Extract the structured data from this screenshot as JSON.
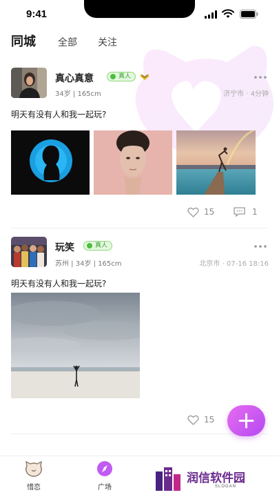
{
  "status_bar": {
    "time": "9:41"
  },
  "tabs": [
    {
      "label": "同城"
    },
    {
      "label": "全部"
    },
    {
      "label": "关注"
    }
  ],
  "posts": [
    {
      "username": "真心真意",
      "verified": "真人",
      "vip_icon": "crown-chevron-icon",
      "meta": "34岁 | 165cm",
      "location_time": "济宁市 · 4分钟",
      "text": "明天有没有人和我一起玩?",
      "photos": [
        "person-silhouette-blue",
        "portrait-woman-pink",
        "woman-dancing-pier-sunset"
      ],
      "likes": "15",
      "comments": "1"
    },
    {
      "username": "玩笑",
      "verified": "真人",
      "meta": "苏州 | 34岁 | 165cm",
      "location_time": "北京市 · 07-16  18:16",
      "text": "明天有没有人和我一起玩?",
      "photos": [
        "woman-on-beach-cloudy-sky"
      ],
      "likes": "15"
    }
  ],
  "bottom_nav": [
    {
      "label": "惜恋",
      "icon": "cat-face-icon"
    },
    {
      "label": "广场",
      "icon": "compass-icon"
    }
  ],
  "fab": {
    "icon": "plus-icon"
  },
  "watermark": {
    "text": "润信软件园",
    "sub": "SLOGAN"
  },
  "colors": {
    "accent": "#c15cf2",
    "verified_green": "#4cbf3f",
    "badge_gold": "#d8a62a"
  }
}
